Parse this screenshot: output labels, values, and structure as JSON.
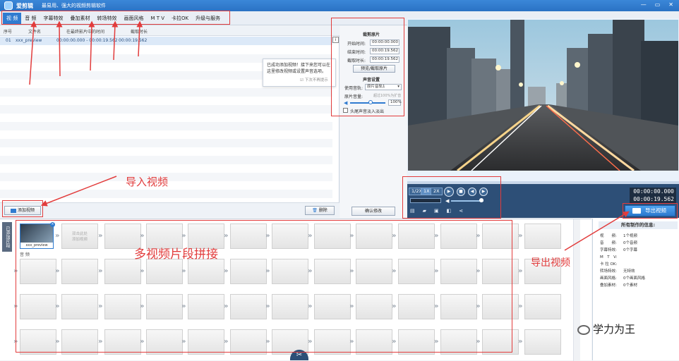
{
  "titlebar": {
    "app": "爱剪辑",
    "tagline": "最易用、强大的视频剪辑软件",
    "minimize": "—",
    "restore": "▭",
    "close": "✕"
  },
  "menu": [
    "视 频",
    "音 频",
    "字幕特效",
    "叠加素材",
    "转场特效",
    "画面风格",
    "M T V",
    "卡拉OK",
    "升级与服务"
  ],
  "table": {
    "headers": [
      "序号",
      "文件名",
      "在最终影片中的时间",
      "截取时长"
    ],
    "rows": [
      {
        "index": "01",
        "name": "xxx_preview",
        "span": "00:00:00.000 - 00:00:19.562",
        "duration": "00:00:19.562"
      }
    ]
  },
  "popup": {
    "line1": "已成功添加视频！接下来您可以在",
    "line2": "这里修改视频或设置声音选项。",
    "checkbox": "下次不再提示"
  },
  "left_buttons": {
    "add": "添加视频",
    "delete": "删除"
  },
  "clip_panel": {
    "trim_title": "裁剪原片",
    "start_label": "开始时间:",
    "start_value": "00:00:00.000",
    "end_label": "结束时间:",
    "end_value": "00:00:19.562",
    "dur_label": "截取时长:",
    "dur_value": "00:00:19.562",
    "preview_btn": "预览/截取原片",
    "sound_title": "声音设置",
    "track_label": "使用音轨:",
    "track_value": "原片音轨1",
    "volume_label": "原片音量:",
    "volume_hint": "超过100%为扩音",
    "volume_value": "100%",
    "fade_label": "头尾声音淡入淡出",
    "confirm": "确认修改"
  },
  "player": {
    "speeds": [
      "1/2X",
      "1X",
      "2X"
    ],
    "time_current": "00:00:00.000",
    "time_total": "00:00:19.562"
  },
  "export": {
    "label": "导出视频"
  },
  "timeline": {
    "side_tab": "已添加片段",
    "first_clip": "xxx_preview",
    "add_hint_1": "双击此处",
    "add_hint_2": "添加视频",
    "audio_label": "音 频"
  },
  "info": {
    "header": "所有制作的信息:",
    "lines": [
      {
        "k": "视　　频:",
        "v": "1个视频"
      },
      {
        "k": "音　　频:",
        "v": "0个音频"
      },
      {
        "k": "字幕特效:",
        "v": "0个字幕"
      },
      {
        "k": "M　T　V:",
        "v": ""
      },
      {
        "k": "卡 拉 OK:",
        "v": ""
      },
      {
        "k": "转场特效:",
        "v": "无特效"
      },
      {
        "k": "画面风格:",
        "v": "0个画面风格"
      },
      {
        "k": "叠加素材:",
        "v": "0个素材"
      }
    ]
  },
  "annotations": {
    "import": "导入视频",
    "splice": "多视频片段拼接",
    "export": "导出视频"
  },
  "watermark": "学力为王",
  "icons": [
    "app-logo-icon",
    "scissors-icon",
    "play-icon",
    "stop-icon",
    "prev-icon",
    "next-icon",
    "volume-icon",
    "export-icon",
    "wechat-icon"
  ]
}
